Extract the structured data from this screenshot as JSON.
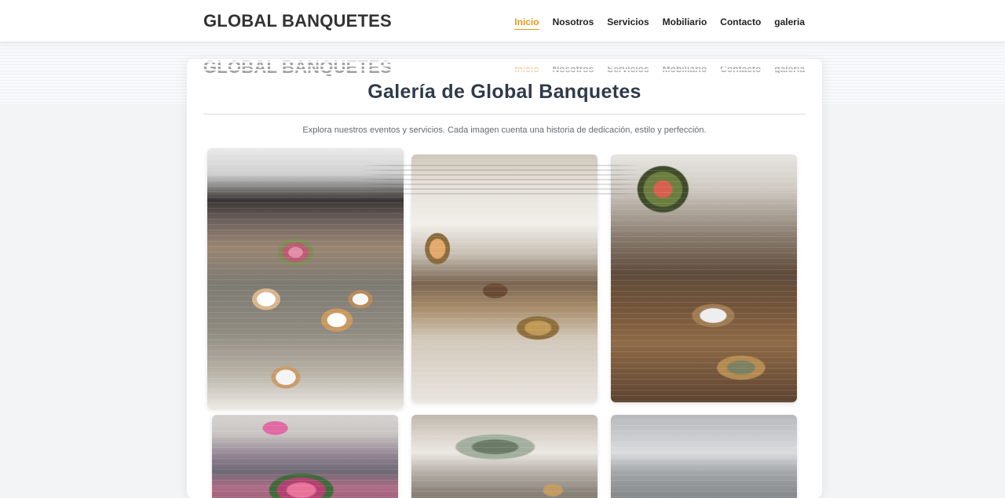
{
  "header": {
    "brand": "GLOBAL BANQUETES",
    "nav": [
      {
        "label": "Inicio",
        "active": true
      },
      {
        "label": "Nosotros",
        "active": false
      },
      {
        "label": "Servicios",
        "active": false
      },
      {
        "label": "Mobiliario",
        "active": false
      },
      {
        "label": "Contacto",
        "active": false
      },
      {
        "label": "galeria",
        "active": false
      }
    ]
  },
  "main": {
    "title": "Galería de Global Banquetes",
    "subtitle": "Explora nuestros eventos y servicios. Cada imagen cuenta una historia de dedicación, estilo y perfección."
  },
  "colors": {
    "accent": "#e39a1a",
    "text_dark": "#2f3b4a",
    "page_bg": "#f3f4f6"
  }
}
